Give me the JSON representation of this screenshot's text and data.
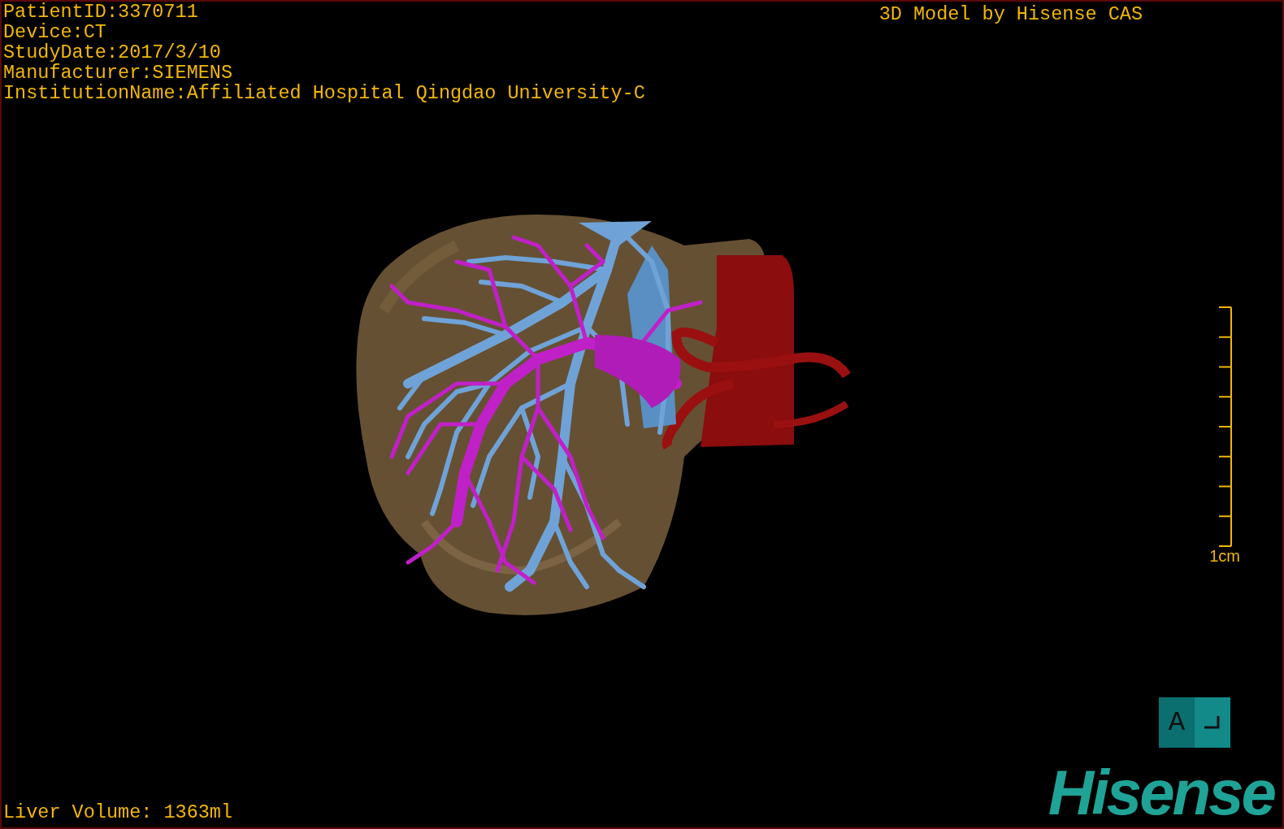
{
  "patient_info": [
    "PatientID:3370711",
    "Device:CT",
    "StudyDate:2017/3/10",
    "Manufacturer:SIEMENS",
    "InstitutionName:Affiliated Hospital Qingdao University-C"
  ],
  "title": "3D Model by Hisense CAS",
  "scale_bar": {
    "label": "1cm"
  },
  "orientation_marker": {
    "label": "A"
  },
  "measurement": "Liver Volume: 1363ml",
  "logo": "Hisense"
}
